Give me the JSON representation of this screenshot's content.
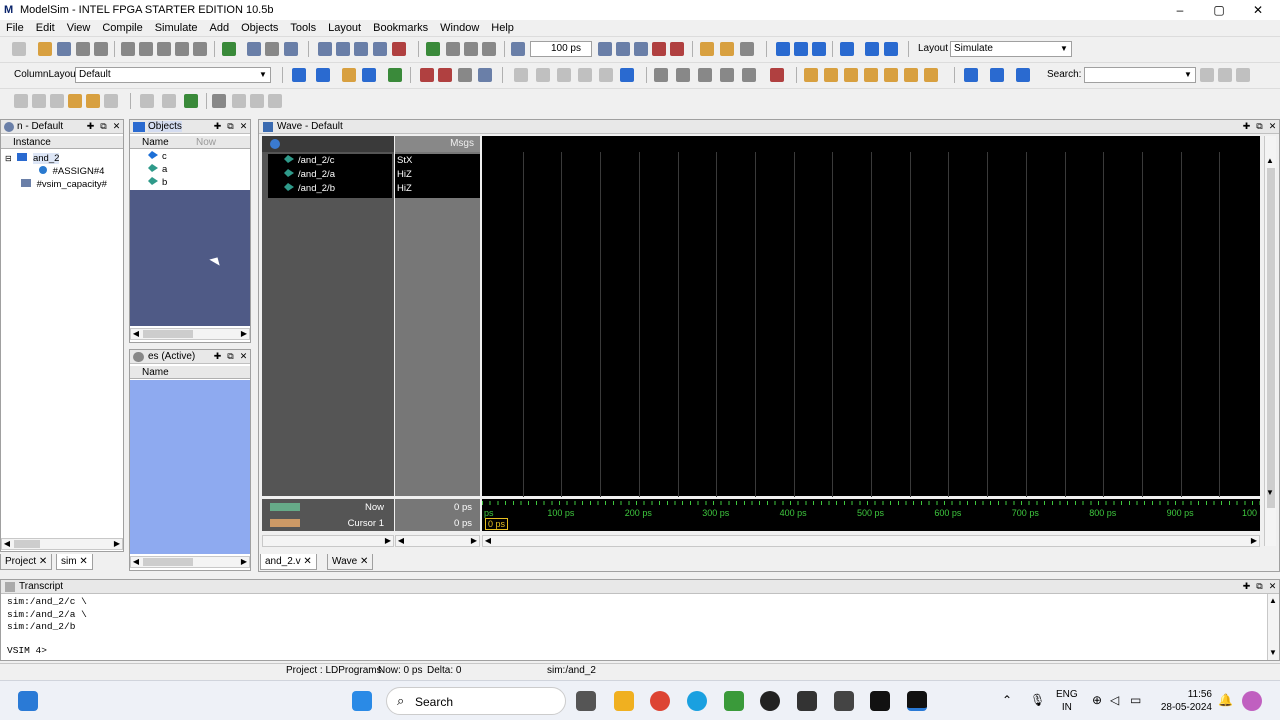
{
  "window": {
    "title": "ModelSim - INTEL FPGA STARTER EDITION 10.5b",
    "logo": "M",
    "controls": [
      "–",
      "▢",
      "✕"
    ]
  },
  "menu": [
    "File",
    "Edit",
    "View",
    "Compile",
    "Simulate",
    "Add",
    "Objects",
    "Tools",
    "Layout",
    "Bookmarks",
    "Window",
    "Help"
  ],
  "toolbar": {
    "run_length": "100 ps",
    "layout_label": "Layout",
    "layout_value": "Simulate",
    "column_layout_label": "ColumnLayout",
    "column_layout_value": "Default",
    "search_label": "Search:"
  },
  "instance_panel": {
    "title": "n - Default",
    "column": "Instance",
    "items": [
      "and_2",
      "#ASSIGN#4",
      "#vsim_capacity#"
    ]
  },
  "objects_panel": {
    "title": "Objects",
    "col_name": "Name",
    "col_now": "Now",
    "items": [
      "c",
      "a",
      "b"
    ]
  },
  "processes_panel": {
    "title": "es (Active)",
    "col_name": "Name"
  },
  "left_tabs": [
    "Project",
    "sim"
  ],
  "wave": {
    "title": "Wave - Default",
    "msgs_label": "Msgs",
    "signals": [
      {
        "name": "/and_2/c",
        "value": "StX"
      },
      {
        "name": "/and_2/a",
        "value": "HiZ"
      },
      {
        "name": "/and_2/b",
        "value": "HiZ"
      }
    ],
    "now_label": "Now",
    "now_value": "0 ps",
    "cursor_label": "Cursor 1",
    "cursor_value": "0 ps",
    "cursor_marker": "0 ps",
    "axis_ticks": [
      "ps",
      "100 ps",
      "200 ps",
      "300 ps",
      "400 ps",
      "500 ps",
      "600 ps",
      "700 ps",
      "800 ps",
      "900 ps",
      "100"
    ],
    "tabs": [
      "and_2.v",
      "Wave"
    ]
  },
  "transcript": {
    "title": "Transcript",
    "lines": [
      "sim:/and_2/c \\",
      "sim:/and_2/a \\",
      "sim:/and_2/b"
    ],
    "prompt": "VSIM 4>"
  },
  "status": {
    "project": "Project : LDPrograms",
    "now": "Now: 0 ps",
    "delta": "Delta: 0",
    "context": "sim:/and_2"
  },
  "taskbar": {
    "search": "Search",
    "lang_top": "ENG",
    "lang_bottom": "IN",
    "time": "11:56",
    "date": "28-05-2024"
  },
  "colors": {
    "wave_bg": "#000000",
    "objects_bg": "#4f5a86",
    "processes_bg": "#8eaaf0",
    "axis_green": "#3ec83e",
    "cursor_yellow": "#e8c020"
  }
}
